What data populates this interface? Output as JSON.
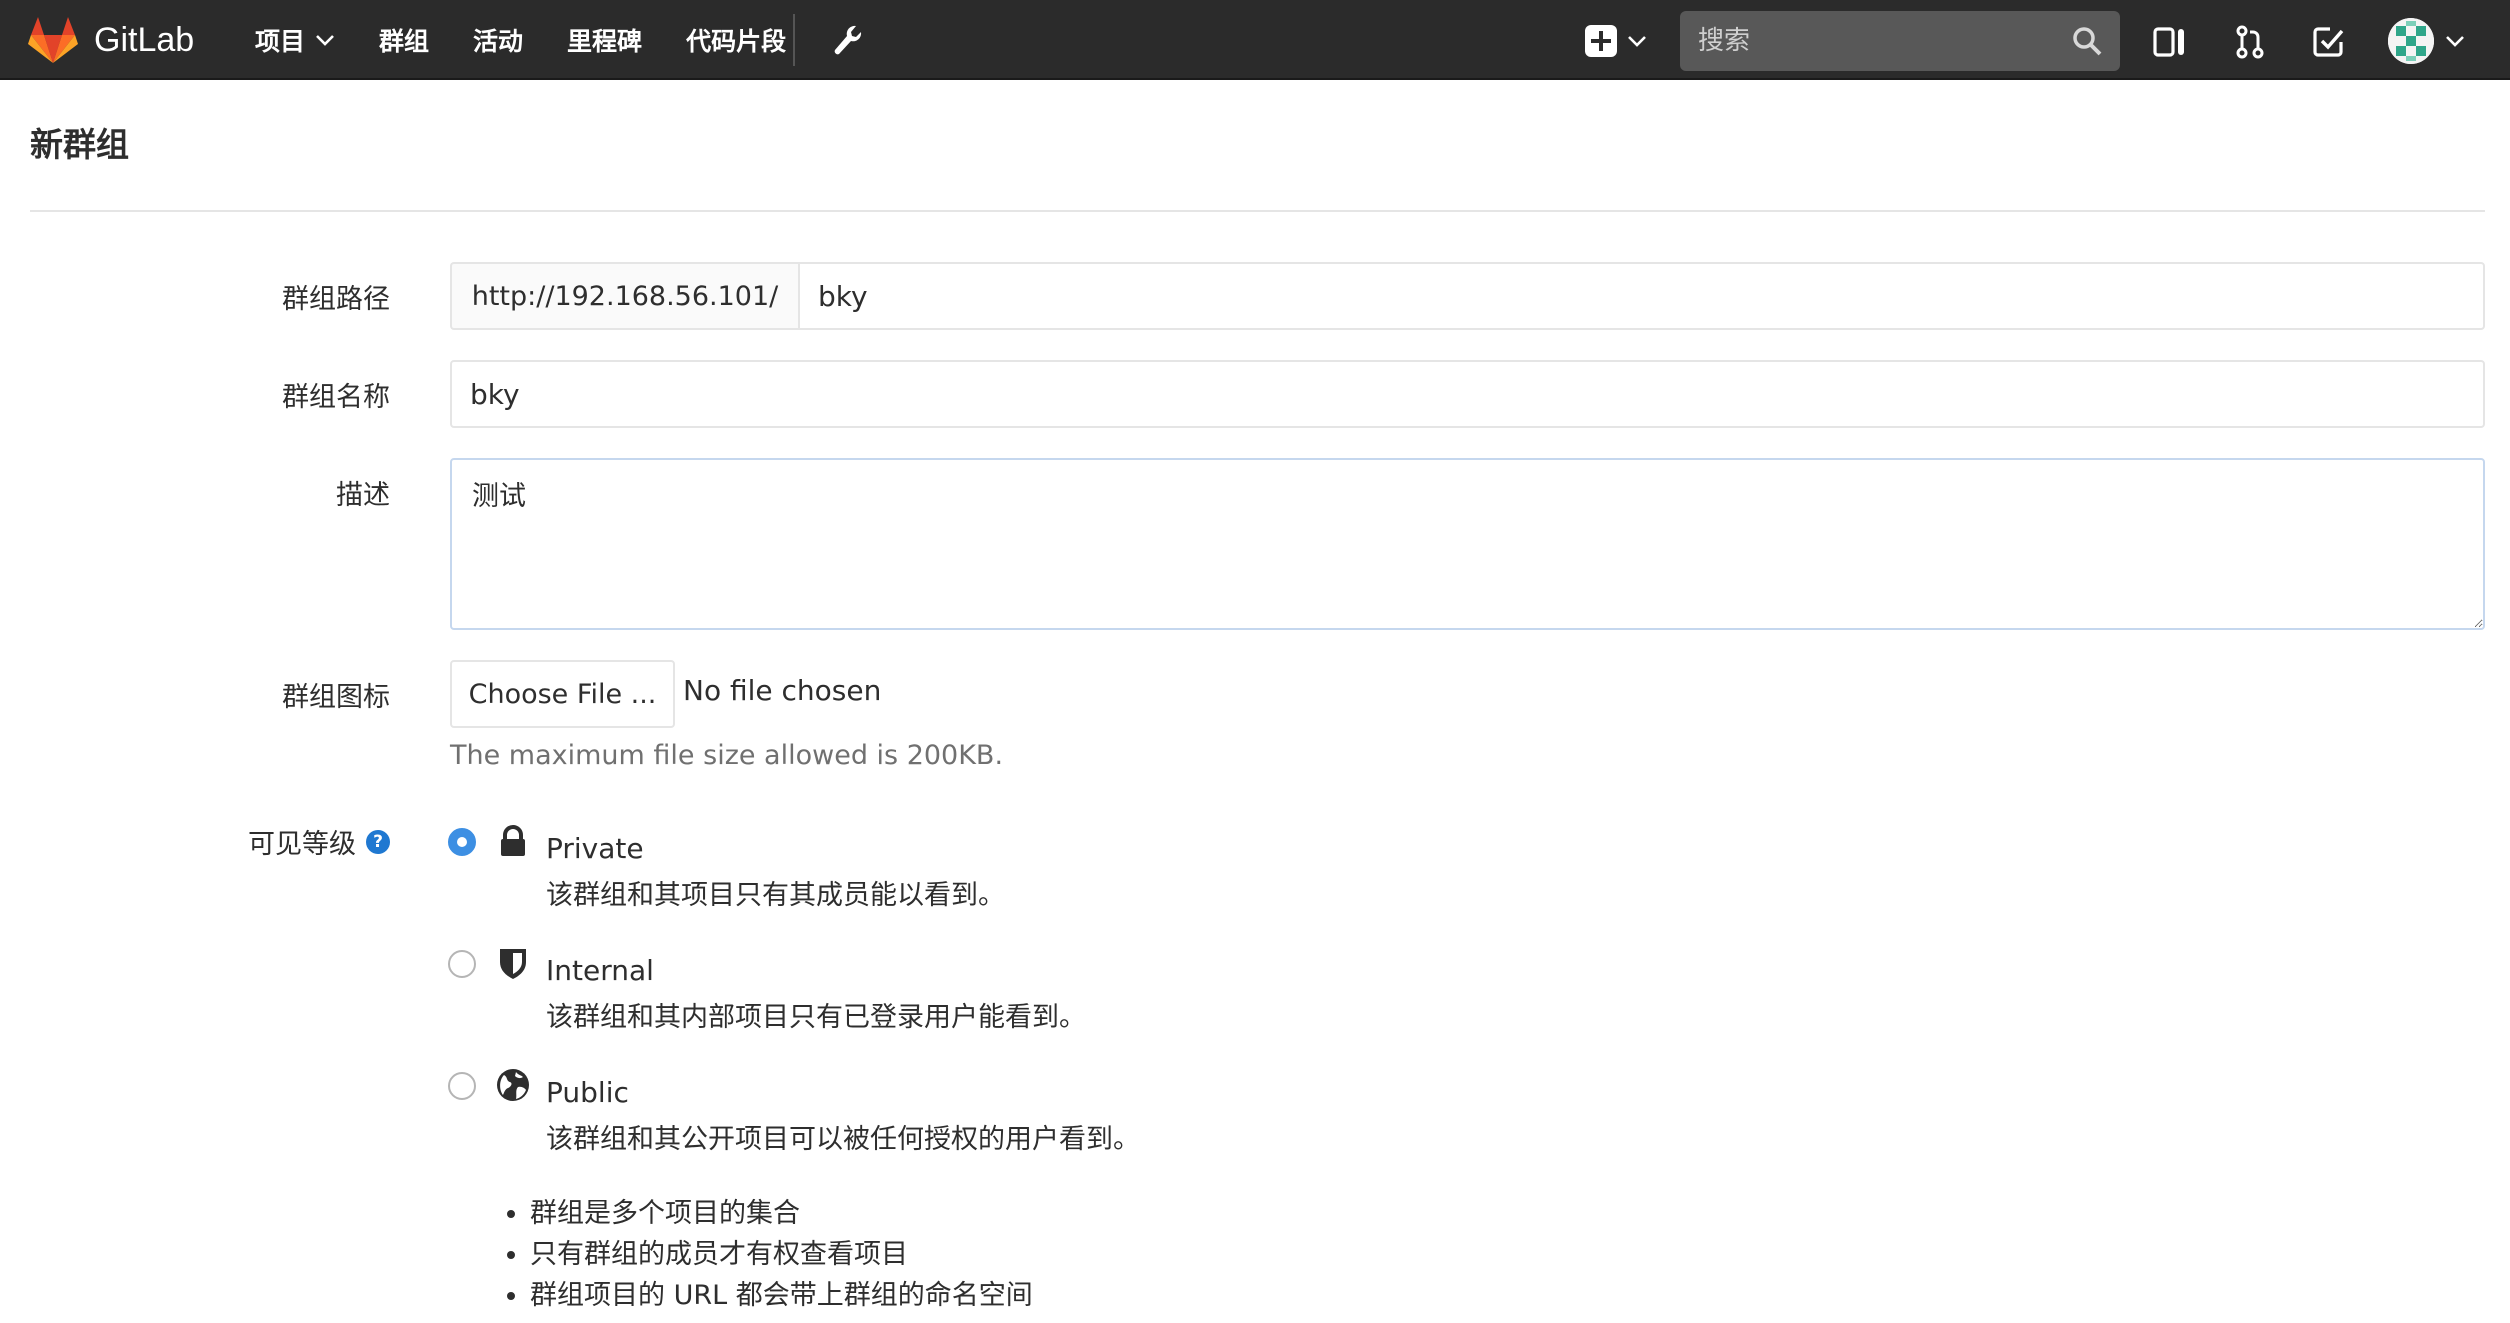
{
  "navbar": {
    "brand": "GitLab",
    "menu": [
      {
        "label": "项目",
        "dropdown": true
      },
      {
        "label": "群组",
        "dropdown": false
      },
      {
        "label": "活动",
        "dropdown": false
      },
      {
        "label": "里程碑",
        "dropdown": false
      },
      {
        "label": "代码片段",
        "dropdown": false
      }
    ],
    "search_placeholder": "搜索"
  },
  "page": {
    "title": "新群组"
  },
  "form": {
    "path_label": "群组路径",
    "path_prefix": "http://192.168.56.101/",
    "path_value": "bky",
    "name_label": "群组名称",
    "name_value": "bky",
    "description_label": "描述",
    "description_value": "测试",
    "avatar_label": "群组图标",
    "choose_file_label": "Choose File ...",
    "file_status": "No file chosen",
    "file_help": "The maximum file size allowed is 200KB.",
    "visibility_label": "可见等级",
    "visibility_help_icon": "?",
    "visibility_options": [
      {
        "title": "Private",
        "desc": "该群组和其项目只有其成员能以看到。",
        "icon": "lock-icon",
        "checked": true
      },
      {
        "title": "Internal",
        "desc": "该群组和其内部项目只有已登录用户能看到。",
        "icon": "shield-icon",
        "checked": false
      },
      {
        "title": "Public",
        "desc": "该群组和其公开项目可以被任何授权的用户看到。",
        "icon": "globe-icon",
        "checked": false
      }
    ],
    "notes": [
      "群组是多个项目的集合",
      "只有群组的成员才有权查看项目",
      "群组项目的 URL 都会带上群组的命名空间"
    ]
  },
  "colors": {
    "navbar_bg": "#2b2b2b",
    "accent": "#1f78d1",
    "radio_checked": "#3d8fe3",
    "logo_orange": "#e24329"
  }
}
